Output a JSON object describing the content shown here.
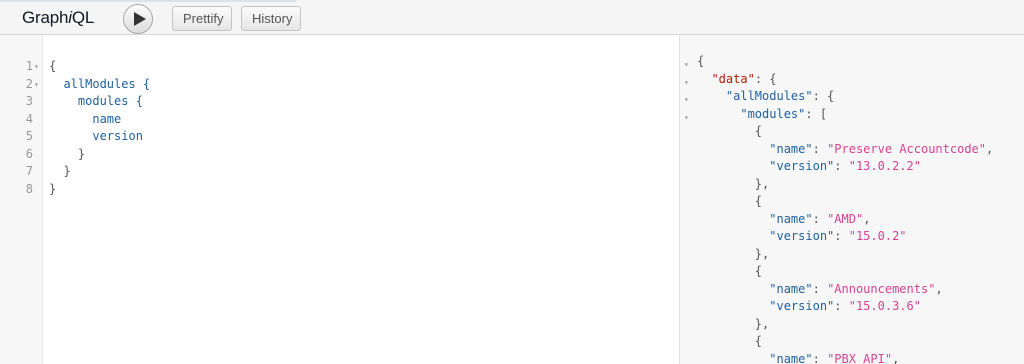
{
  "app": {
    "title_prefix": "Graph",
    "title_italic": "i",
    "title_suffix": "QL"
  },
  "toolbar": {
    "execute_label": "Execute Query",
    "prettify_label": "Prettify",
    "history_label": "History"
  },
  "query_lines": [
    {
      "num": "1",
      "fold": true,
      "indent": "",
      "text": "{",
      "kind": "punc"
    },
    {
      "num": "2",
      "fold": true,
      "indent": "  ",
      "text": "allModules {",
      "kind": "field"
    },
    {
      "num": "3",
      "fold": false,
      "indent": "    ",
      "text": "modules {",
      "kind": "field"
    },
    {
      "num": "4",
      "fold": false,
      "indent": "      ",
      "text": "name",
      "kind": "field"
    },
    {
      "num": "5",
      "fold": false,
      "indent": "      ",
      "text": "version",
      "kind": "field"
    },
    {
      "num": "6",
      "fold": false,
      "indent": "    ",
      "text": "}",
      "kind": "punc"
    },
    {
      "num": "7",
      "fold": false,
      "indent": "  ",
      "text": "}",
      "kind": "punc"
    },
    {
      "num": "8",
      "fold": false,
      "indent": "",
      "text": "}",
      "kind": "punc"
    }
  ],
  "result_lines": [
    {
      "fold": true,
      "parts": [
        [
          "punc",
          "{"
        ]
      ]
    },
    {
      "fold": true,
      "parts": [
        [
          "punc",
          "  "
        ],
        [
          "dkey",
          "\"data\""
        ],
        [
          "punc",
          ": {"
        ]
      ]
    },
    {
      "fold": true,
      "parts": [
        [
          "punc",
          "    "
        ],
        [
          "key",
          "\"allModules\""
        ],
        [
          "punc",
          ": {"
        ]
      ]
    },
    {
      "fold": true,
      "parts": [
        [
          "punc",
          "      "
        ],
        [
          "key",
          "\"modules\""
        ],
        [
          "punc",
          ": ["
        ]
      ]
    },
    {
      "fold": false,
      "parts": [
        [
          "punc",
          "        {"
        ]
      ]
    },
    {
      "fold": false,
      "parts": [
        [
          "punc",
          "          "
        ],
        [
          "key",
          "\"name\""
        ],
        [
          "punc",
          ": "
        ],
        [
          "str",
          "\"Preserve Accountcode\""
        ],
        [
          "punc",
          ","
        ]
      ]
    },
    {
      "fold": false,
      "parts": [
        [
          "punc",
          "          "
        ],
        [
          "key",
          "\"version\""
        ],
        [
          "punc",
          ": "
        ],
        [
          "str",
          "\"13.0.2.2\""
        ]
      ]
    },
    {
      "fold": false,
      "parts": [
        [
          "punc",
          "        },"
        ]
      ]
    },
    {
      "fold": false,
      "parts": [
        [
          "punc",
          "        {"
        ]
      ]
    },
    {
      "fold": false,
      "parts": [
        [
          "punc",
          "          "
        ],
        [
          "key",
          "\"name\""
        ],
        [
          "punc",
          ": "
        ],
        [
          "str",
          "\"AMD\""
        ],
        [
          "punc",
          ","
        ]
      ]
    },
    {
      "fold": false,
      "parts": [
        [
          "punc",
          "          "
        ],
        [
          "key",
          "\"version\""
        ],
        [
          "punc",
          ": "
        ],
        [
          "str",
          "\"15.0.2\""
        ]
      ]
    },
    {
      "fold": false,
      "parts": [
        [
          "punc",
          "        },"
        ]
      ]
    },
    {
      "fold": false,
      "parts": [
        [
          "punc",
          "        {"
        ]
      ]
    },
    {
      "fold": false,
      "parts": [
        [
          "punc",
          "          "
        ],
        [
          "key",
          "\"name\""
        ],
        [
          "punc",
          ": "
        ],
        [
          "str",
          "\"Announcements\""
        ],
        [
          "punc",
          ","
        ]
      ]
    },
    {
      "fold": false,
      "parts": [
        [
          "punc",
          "          "
        ],
        [
          "key",
          "\"version\""
        ],
        [
          "punc",
          ": "
        ],
        [
          "str",
          "\"15.0.3.6\""
        ]
      ]
    },
    {
      "fold": false,
      "parts": [
        [
          "punc",
          "        },"
        ]
      ]
    },
    {
      "fold": false,
      "parts": [
        [
          "punc",
          "        {"
        ]
      ]
    },
    {
      "fold": false,
      "parts": [
        [
          "punc",
          "          "
        ],
        [
          "key",
          "\"name\""
        ],
        [
          "punc",
          ": "
        ],
        [
          "str",
          "\"PBX API\""
        ],
        [
          "punc",
          ","
        ]
      ]
    }
  ],
  "colors": {
    "field": "#1f61a0",
    "string": "#d64292",
    "data_key": "#b11a04",
    "toolbar_bg": "#f5f5f5",
    "gutter_bg": "#f7f7f7"
  }
}
